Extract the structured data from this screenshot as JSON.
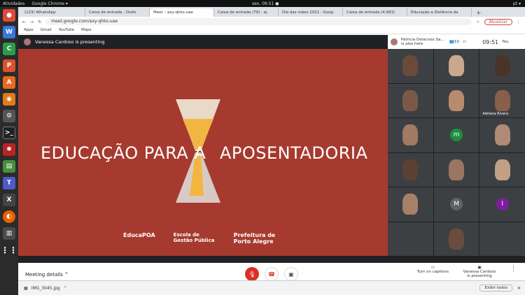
{
  "topbar": {
    "activities": "Atividades",
    "app": "Google Chrome ▾",
    "clock": "sex, 09:51 ●",
    "lang": "pt ▾"
  },
  "tabs": [
    "(123) WhatsApp",
    "Caixa de entrada - Outlo",
    "Meet – axy-qhks-uae",
    "Caixa de entrada (79) - ej",
    "Dia das mães 2021 - Goog",
    "Caixa de entrada (4.993)",
    "Educação a Distância da"
  ],
  "tab_add": "+",
  "url": "meet.google.com/axy-qhks-uae",
  "update_label": "Atualizar",
  "bookmarks": [
    "Apps",
    "Gmail",
    "YouTube",
    "Maps"
  ],
  "meet": {
    "presenter_text": "Vanessa Cardoso is presenting",
    "also_here": "Patricia Delacroix Sa... is also here",
    "participants_count": "10",
    "time": "09:51",
    "you": "You",
    "slide": {
      "title_left": "EDUCAÇÃO PARA A",
      "title_right": "APOSENTADORIA",
      "logos": [
        {
          "name": "EducaPOA",
          "sub": ""
        },
        {
          "name": "Escola de Gestão Pública",
          "sub": ""
        },
        {
          "name": "Prefeitura de Porto Alegre",
          "sub": ""
        }
      ]
    },
    "tiles": [
      {
        "type": "face",
        "color": "#6b4a3a"
      },
      {
        "type": "face",
        "color": "#c9a98c"
      },
      {
        "type": "face",
        "color": "#4a3328"
      },
      {
        "type": "face",
        "color": "#7a5a46"
      },
      {
        "type": "face",
        "color": "#b88a6e"
      },
      {
        "type": "face",
        "color": "#8a5f4a",
        "label": "Adriana Rivera"
      },
      {
        "type": "face",
        "color": "#a07a62"
      },
      {
        "type": "circle",
        "letter": "m",
        "color": "#1e8e3e"
      },
      {
        "type": "face",
        "color": "#b08a74"
      },
      {
        "type": "face",
        "color": "#5c4034"
      },
      {
        "type": "face",
        "color": "#9a7662"
      },
      {
        "type": "face",
        "color": "#c2a088"
      },
      {
        "type": "face",
        "color": "#a88068"
      },
      {
        "type": "circle",
        "letter": "M",
        "color": "#5f6368"
      },
      {
        "type": "circle",
        "letter": "I",
        "color": "#7b1fa2"
      },
      {
        "type": "empty"
      },
      {
        "type": "face",
        "color": "#6a4c3e"
      },
      {
        "type": "empty"
      }
    ],
    "meeting_details": "Meeting details ^",
    "captions_label": "Turn on captions",
    "presenting_label": "Vanessa Cardoso is presenting"
  },
  "downloads": {
    "file": "IMG_3045.jpg",
    "show_all": "Exibir todos"
  }
}
